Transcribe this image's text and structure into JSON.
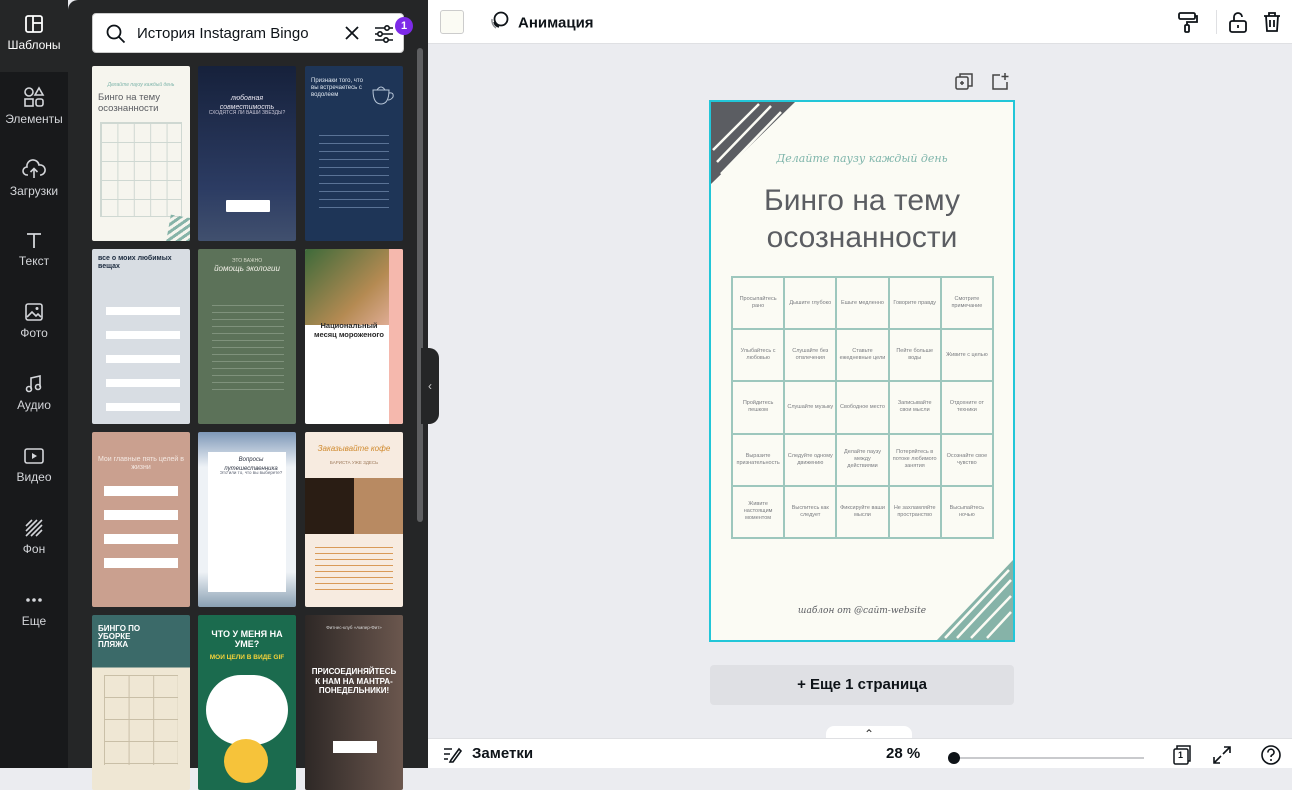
{
  "rail": {
    "items": [
      {
        "label": "Шаблоны",
        "icon": "templates-icon"
      },
      {
        "label": "Элементы",
        "icon": "elements-icon"
      },
      {
        "label": "Загрузки",
        "icon": "upload-cloud-icon"
      },
      {
        "label": "Текст",
        "icon": "text-icon"
      },
      {
        "label": "Фото",
        "icon": "photo-icon"
      },
      {
        "label": "Аудио",
        "icon": "music-note-icon"
      },
      {
        "label": "Видео",
        "icon": "video-icon"
      },
      {
        "label": "Фон",
        "icon": "background-pattern-icon"
      },
      {
        "label": "Еще",
        "icon": "more-dots-icon"
      }
    ]
  },
  "search": {
    "value": "История Instagram Bingo",
    "filter_count": "1"
  },
  "templates": [
    {
      "title": "Бинго на тему осознанности",
      "subtitle": "Делайте паузу каждый день",
      "bg": "#f6f5ee",
      "fg": "#5b5d62"
    },
    {
      "title": "любовная совместимость",
      "subtitle": "СХОДЯТСЯ ЛИ ВАШИ ЗВЕЗДЫ?",
      "bg": "#1f2c4d",
      "fg": "#e8e6f0"
    },
    {
      "title": "Признаки того, что вы встречаетесь с водолеем",
      "subtitle": "",
      "bg": "#1e3557",
      "fg": "#dfe7f0"
    },
    {
      "title": "все о моих любимых вещах",
      "subtitle": "",
      "bg": "#d8dde3",
      "fg": "#1c2b3f"
    },
    {
      "title": "йомощь экологии",
      "subtitle": "ЭТО ВАЖНО",
      "bg": "#5c7259",
      "fg": "#f0efe6"
    },
    {
      "title": "Национальный месяц мороженого",
      "subtitle": "",
      "bg": "#ffffff",
      "fg": "#2a2a2a"
    },
    {
      "title": "Мои главные пять целей в жизни",
      "subtitle": "",
      "bg": "#caa08f",
      "fg": "#f4e8e2"
    },
    {
      "title": "Вопросы путешественника",
      "subtitle": "Это или то, что вы выберете?",
      "bg": "#eef2f6",
      "fg": "#2a3140"
    },
    {
      "title": "Заказывайте кофе",
      "subtitle": "БАРИСТА УЖЕ ЗДЕСЬ",
      "bg": "#f7ebe0",
      "fg": "#d08a2e"
    },
    {
      "title": "БИНГО ПО УБОРКЕ ПЛЯЖА",
      "subtitle": "",
      "bg": "#3b6a69",
      "fg": "#ffffff"
    },
    {
      "title": "ЧТО У МЕНЯ НА УМЕ?",
      "subtitle": "МОИ ЦЕЛИ В ВИДЕ GIF",
      "bg": "#1b6b4e",
      "fg": "#ffffff"
    },
    {
      "title": "ПРИСОЕДИНЯЙТЕСЬ К НАМ НА МАНТРА-ПОНЕДЕЛЬНИКИ!",
      "subtitle": "Фитнес-клуб «Ампер-Фит»",
      "bg": "#3a3331",
      "fg": "#ffffff"
    }
  ],
  "topbar": {
    "animation_label": "Анимация"
  },
  "page": {
    "subtitle": "Делайте паузу каждый день",
    "title_line1": "Бинго на тему",
    "title_line2": "осознанности",
    "footer": "шаблон от @сайт-website",
    "cells": [
      "Просыпайтесь рано",
      "Дышите глубоко",
      "Ешьте медленно",
      "Говорите правду",
      "Смотрите примечание",
      "Улыбайтесь с любовью",
      "Слушайте без отвлечения",
      "Ставьте ежедневные цели",
      "Пейте больше воды",
      "Живите с целью",
      "Пройдитесь пешком",
      "Слушайте музыку",
      "Свободное место",
      "Записывайте свои мысли",
      "Отдохните от техники",
      "Выразите признательность",
      "Следуйте одному движению",
      "Делайте паузу между действиями",
      "Потеряйтесь в потоке любимого занятия",
      "Осознайте свое чувство",
      "Живите настоящим моментом",
      "Выспитесь как следует",
      "Фиксируйте ваши мысли",
      "Не захламляйте пространство",
      "Высыпайтесь ночью"
    ]
  },
  "add_page_label": "+ Еще 1 страница",
  "bottombar": {
    "notes_label": "Заметки",
    "zoom_label": "28 %",
    "zoom_value_percent": 28,
    "page_count": "1"
  }
}
